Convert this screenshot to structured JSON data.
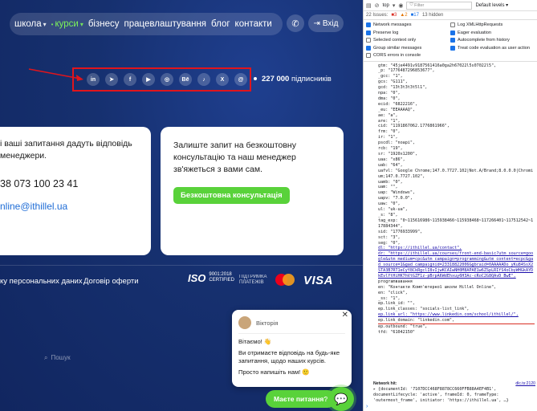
{
  "site": {
    "nav": [
      {
        "label": "школа",
        "chevron": true,
        "active": false
      },
      {
        "label": "курси",
        "chevron": true,
        "active": true
      },
      {
        "label": "бізнесу",
        "chevron": false,
        "active": false
      },
      {
        "label": "працевлаштування",
        "chevron": false,
        "active": false
      },
      {
        "label": "блог",
        "chevron": false,
        "active": false
      },
      {
        "label": "контакти",
        "chevron": false,
        "active": false
      }
    ],
    "login_label": "Вхід",
    "social_icons": [
      {
        "icon": "linkedin-icon",
        "glyph": "in"
      },
      {
        "icon": "telegram-icon",
        "glyph": "➤"
      },
      {
        "icon": "facebook-icon",
        "glyph": "f"
      },
      {
        "icon": "youtube-icon",
        "glyph": "▶"
      },
      {
        "icon": "instagram-icon",
        "glyph": "◎"
      },
      {
        "icon": "behance-icon",
        "glyph": "Bē"
      },
      {
        "icon": "tiktok-icon",
        "glyph": "♪"
      },
      {
        "icon": "x-icon",
        "glyph": "X"
      },
      {
        "icon": "threads-icon",
        "glyph": "@"
      }
    ],
    "subscribers_count": "227 000",
    "subscribers_label": "підписників",
    "card_left": {
      "text": "і ваші запитання дадуть відповідь менеджери.",
      "phone": "38 073 100 23 41",
      "email": "nline@ithillel.ua"
    },
    "card_right": {
      "text": "Залиште запит на безкоштовну консультацію та наш менеджер зв'яжеться з вами сам.",
      "button": "Безкоштовна консультація"
    },
    "footer": {
      "privacy": "ку персональних даних",
      "offer": "Договір оферти",
      "iso": "ISO",
      "iso_sub1": "9001:2018",
      "iso_sub2": "CERTIFIED",
      "pay_line1": "ПІДТРИМКА",
      "pay_line2": "ПЛАТЕЖІВ",
      "visa": "VISA"
    },
    "search_placeholder": "Пошук",
    "chat": {
      "agent": "Вікторія",
      "line1": "Вітаємо! 👋",
      "line2": "Ви отримаєте відповідь на будь-яке запитання, щодо наших курсів.",
      "line3": "Просто напишіть нам! 🙂",
      "ask_button": "Маєте питання?"
    },
    "colors": {
      "accent": "#59d23a",
      "bg": "#16306f",
      "highlight": "#e0151c"
    }
  },
  "devtools": {
    "context": "top",
    "filter_placeholder": "Filter",
    "levels": "Default levels ▾",
    "issues_label": "22 Issues:",
    "issues_red": "3",
    "issues_yellow": "2",
    "issues_blue": "17",
    "hidden": "13 hidden",
    "settings": [
      {
        "label": "Network messages",
        "on": true
      },
      {
        "label": "Log XMLHttpRequests",
        "on": false
      },
      {
        "label": "Preserve log",
        "on": true
      },
      {
        "label": "Eager evaluation",
        "on": true
      },
      {
        "label": "Selected context only",
        "on": false
      },
      {
        "label": "Autocomplete from history",
        "on": true
      },
      {
        "label": "Group similar messages",
        "on": true
      },
      {
        "label": "Treat code evaluation as user action",
        "on": true
      },
      {
        "label": "CORS errors in console",
        "on": false
      }
    ],
    "code_lines": [
      "gtm: \"45je4491v9187561416a0ga2h67022l5s07022l5\",",
      "_p: \"1776487296853677\",",
      "_gcc: \"1\",",
      "gcs: \"G111\",",
      "gcd: \"13t3t3t3t5l1\",",
      "npa: \"0\",",
      "dma: \"0\",",
      "ecid: \"6822216\",",
      "_eu: \"EEAAAAQ\",",
      "ae: \"a\",",
      "are: \"1\",",
      "cid: \"1191867062.1776861966\",",
      "frm: \"0\",",
      "ir: \"1\",",
      "pscdl: \"noapi\",",
      "rcb: \"19\",",
      "sr: \"1920x1200\",",
      "uaa: \"x86\",",
      "uab: \"64\",",
      "uafvl: \"Google Chrome;147.0.7727.102|Not.A/Brand;8.0.0.0|Chromium;147.0.7727.102\",",
      "uamb: \"0\",",
      "uam: \"\",",
      "uap: \"Windows\",",
      "uapv: \"7.0.0\",",
      "uaw: \"0\",",
      "ul: \"uk-ua\",",
      "_s: \"8\",",
      "tag_exp: \"0~115616986~115938466~115938468~117266401~117512542~117884344\",",
      "sid: \"1776933999\",",
      "sct: \"3\",",
      "seg: \"0\",",
      "dl: \"https://ithillel.ua/contact\",",
      "dr: \"https://ithillel.ua/courses/front-end-basic?utm_source=google&utm_medium=cpc&utm_campaign=programming&utm_content=ecpc&gad_source=1&gad_campaignid=23318822006&gbraid=0AAAAADo_yKu84SsX2STA3B7RT1eCyY8CkRgclI8vIjwKCAIwNH0M8APAE1w6ZSpLRIfS4oCbyWHGkAYDkEvlYtHiHK7hVtGZF1z-pBrpA6WdEhxuy6H3Ac-cRoC2G8QAvD_BwE\",",
      "programвавання",
      "en: \"Контакти Комп'ютерної школи Hillel Online\",",
      "en: \"click\",",
      "_ss: \"1\",",
      "ep.link_id: \"\",",
      "ep.link_classes: \"socials-list_link\",",
      "ep.link_url: \"https://www.linkedin.com/school/ithillel/\",",
      "ep.link_domain: \"linkedin.com\",",
      "ep.outbound: \"true\",",
      "tfd: \"61042150\""
    ],
    "network_hit": "Network hit:",
    "network_ref": "dlc.ts:2120",
    "network_line": "▸ {documentId: '7107DCC468F8878CC660FFB88A4EF4B1', documentLifecycle: 'active', frameId: 0, frameType: 'outermost_frame', initiator: 'https://ithillel.ua', …}"
  }
}
